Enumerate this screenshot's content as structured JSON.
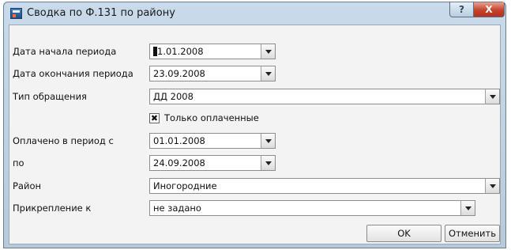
{
  "window": {
    "title": "Сводка по Ф.131 по району",
    "help_label": "?",
    "close_label": "X"
  },
  "form": {
    "start_date": {
      "label": "Дата начала периода",
      "value": "1.01.2008",
      "caret_char": "0"
    },
    "end_date": {
      "label": "Дата окончания периода",
      "value": "23.09.2008"
    },
    "request_type": {
      "label": "Тип обращения",
      "value": "ДД 2008"
    },
    "paid_only": {
      "label": "Только оплаченные",
      "checked": true,
      "mark": "✖"
    },
    "paid_from": {
      "label": "Оплачено в период с",
      "value": "01.01.2008"
    },
    "paid_to": {
      "label": "по",
      "value": "24.09.2008"
    },
    "district": {
      "label": "Район",
      "value": "Иногородние"
    },
    "attachment": {
      "label": "Прикрепление к",
      "value": "не задано"
    }
  },
  "buttons": {
    "ok": "OK",
    "cancel": "Отменить"
  }
}
